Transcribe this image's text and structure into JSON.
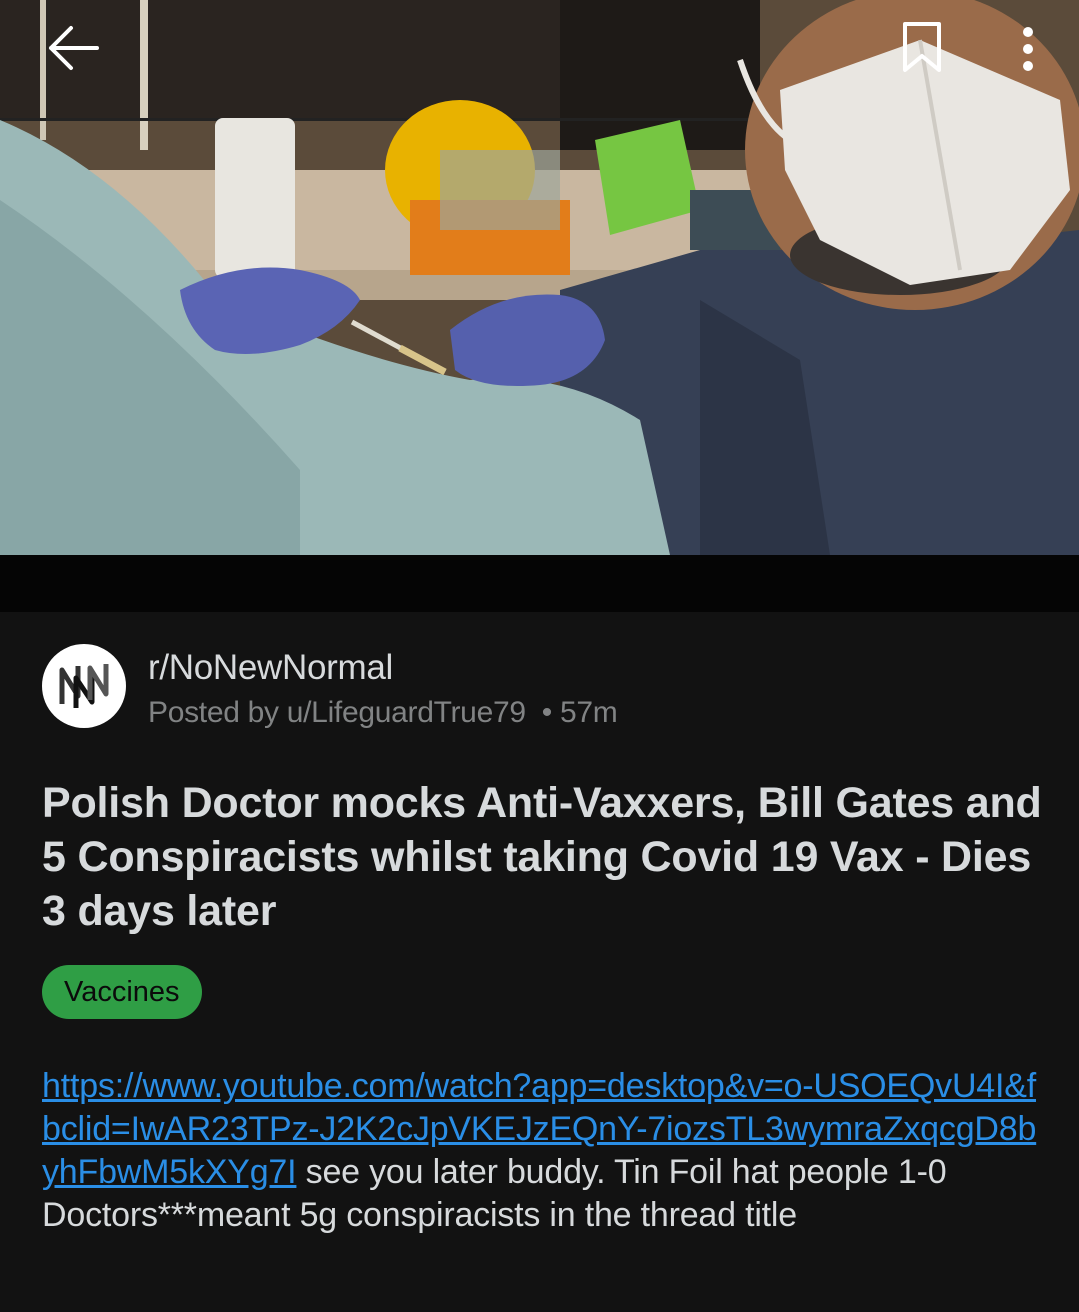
{
  "toolbar": {
    "back_icon": "back-arrow-icon",
    "save_icon": "bookmark-icon",
    "more_icon": "more-vertical-icon"
  },
  "media": {
    "type": "image"
  },
  "post": {
    "subreddit": "r/NoNewNormal",
    "posted_by_prefix": "Posted by",
    "username": "u/LifeguardTrue79",
    "separator": "•",
    "time_ago": "57m",
    "title": "Polish Doctor mocks Anti-Vaxxers, Bill Gates and 5 Conspiracists whilst taking Covid 19 Vax - Dies 3 days later",
    "flair": "Vaccines",
    "body_link": "https://www.youtube.com/watch?app=desktop&v=o-USOEQvU4I&fbclid=IwAR23TPz-J2K2cJpVKEJzEQnY-7iozsTL3wymraZxqcgD8byhFbwM5kXYg7I",
    "body_text": " see you later buddy. Tin Foil hat people 1-0 Doctors***meant 5g conspiracists in the thread title"
  },
  "colors": {
    "background": "#121212",
    "text_primary": "#d7dadc",
    "text_secondary": "#818384",
    "link": "#2a8ee6",
    "flair_bg": "#2f9e45"
  }
}
